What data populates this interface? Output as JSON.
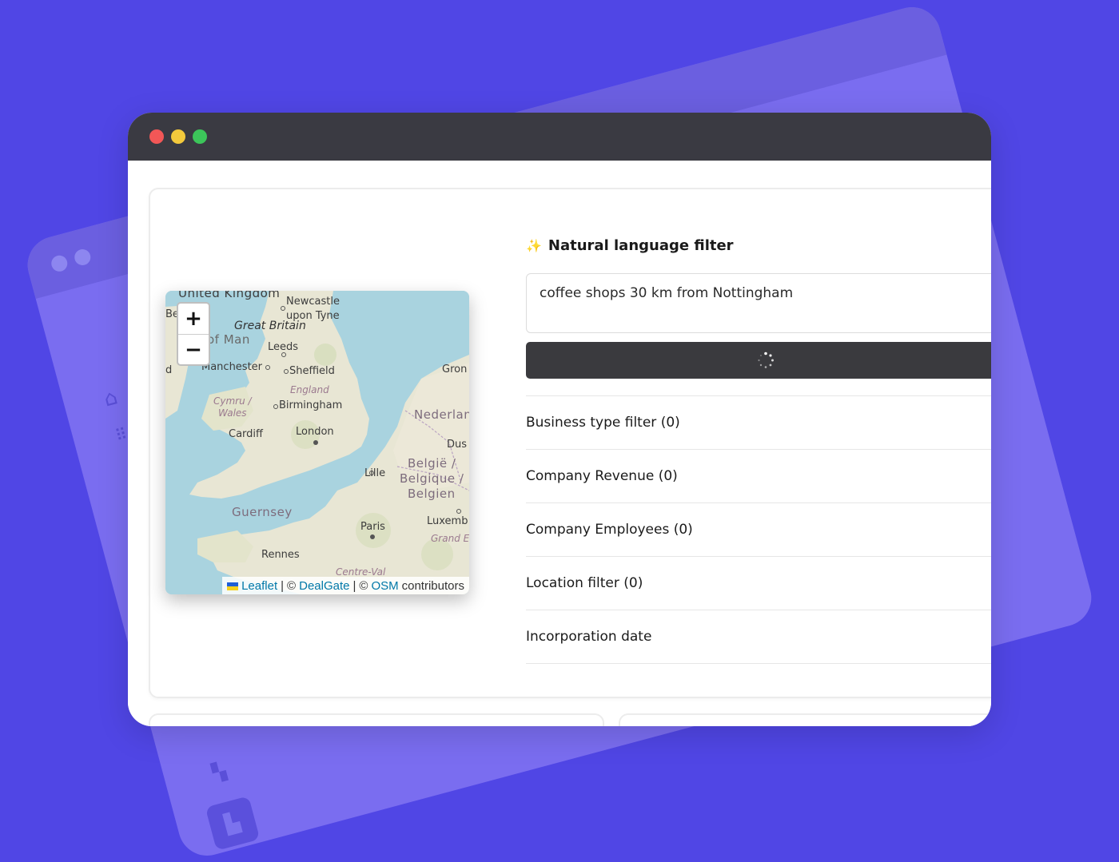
{
  "window": {
    "traffic_lights": [
      "close",
      "minimize",
      "maximize"
    ]
  },
  "filter": {
    "title": "Natural language filter",
    "sparkle_icon": "sparkle-icon",
    "query": "coffee shops 30 km from Nottingham",
    "button_state": "loading"
  },
  "filters": [
    {
      "label": "Business type filter (0)"
    },
    {
      "label": "Company Revenue (0)"
    },
    {
      "label": "Company Employees (0)"
    },
    {
      "label": "Location filter (0)"
    },
    {
      "label": "Incorporation date"
    }
  ],
  "map": {
    "zoom_in": "+",
    "zoom_out": "−",
    "labels": {
      "uk": "United Kingdom",
      "newcastle_1": "Newcastle",
      "newcastle_2": "upon Tyne",
      "great_britain": "Great Britain",
      "isle_of_man": "of Man",
      "leeds": "Leeds",
      "manchester": "Manchester",
      "sheffield": "Sheffield",
      "england": "England",
      "cymru": "Cymru /",
      "wales": "Wales",
      "birmingham": "Birmingham",
      "cardiff": "Cardiff",
      "london": "London",
      "groningen": "Gron",
      "nederland": "Nederlan",
      "dus": "Dus",
      "belgie_1": "België /",
      "belgie_2": "Belgique /",
      "belgie_3": "Belgien",
      "lille": "Lille",
      "guernsey": "Guernsey",
      "paris": "Paris",
      "luxemb": "Luxemb",
      "grand_est": "Grand E",
      "rennes": "Rennes",
      "centre_val": "Centre-Val",
      "be": "Be",
      "d": "d"
    },
    "attribution": {
      "leaflet": "Leaflet",
      "sep1": "|",
      "dealgate_prefix": "©",
      "dealgate": "DealGate",
      "sep2": "|",
      "osm_prefix": "©",
      "osm": "OSM",
      "contributors": "contributors"
    }
  },
  "colors": {
    "background": "#5046e5",
    "titlebar": "#3a3a42",
    "button": "#3a3a3e",
    "sea": "#a9d3df",
    "land": "#e8e6d4",
    "link": "#0078a8"
  }
}
